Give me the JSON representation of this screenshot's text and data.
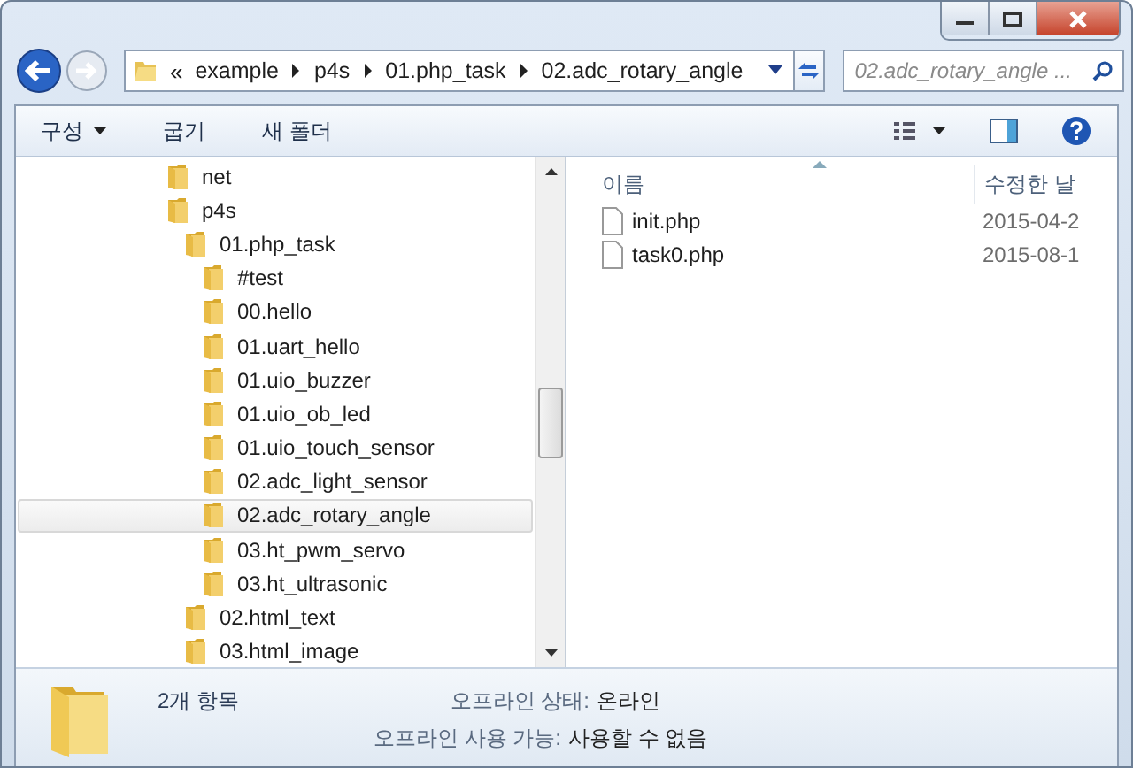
{
  "address_bar": {
    "overflow": "«",
    "crumbs": [
      "example",
      "p4s",
      "01.php_task",
      "02.adc_rotary_angle"
    ]
  },
  "search": {
    "placeholder": "02.adc_rotary_angle ..."
  },
  "toolbar": {
    "buttons": [
      {
        "label": "구성",
        "dropdown": true
      },
      {
        "label": "굽기",
        "dropdown": false
      },
      {
        "label": "새 폴더",
        "dropdown": false
      }
    ]
  },
  "nav_tree": [
    {
      "label": "net",
      "selected": false
    },
    {
      "label": "p4s",
      "selected": false,
      "children": [
        {
          "label": "01.php_task",
          "selected": false,
          "children": [
            {
              "label": "#test",
              "selected": false
            },
            {
              "label": "00.hello",
              "selected": false
            },
            {
              "label": "01.uart_hello",
              "selected": false
            },
            {
              "label": "01.uio_buzzer",
              "selected": false
            },
            {
              "label": "01.uio_ob_led",
              "selected": false
            },
            {
              "label": "01.uio_touch_sensor",
              "selected": false
            },
            {
              "label": "02.adc_light_sensor",
              "selected": false
            },
            {
              "label": "02.adc_rotary_angle",
              "selected": true
            },
            {
              "label": "03.ht_pwm_servo",
              "selected": false
            },
            {
              "label": "03.ht_ultrasonic",
              "selected": false
            }
          ]
        },
        {
          "label": "02.html_text",
          "selected": false
        },
        {
          "label": "03.html_image",
          "selected": false
        }
      ]
    }
  ],
  "file_list": {
    "columns": [
      "이름",
      "수정한 날"
    ],
    "rows": [
      {
        "name": "init.php",
        "date": "2015-04-2"
      },
      {
        "name": "task0.php",
        "date": "2015-08-1"
      }
    ]
  },
  "status_bar": {
    "count": "2개 항목",
    "details": [
      {
        "label": "오프라인 상태:",
        "value": "온라인"
      },
      {
        "label": "오프라인 사용 가능:",
        "value": "사용할 수 없음"
      }
    ]
  }
}
